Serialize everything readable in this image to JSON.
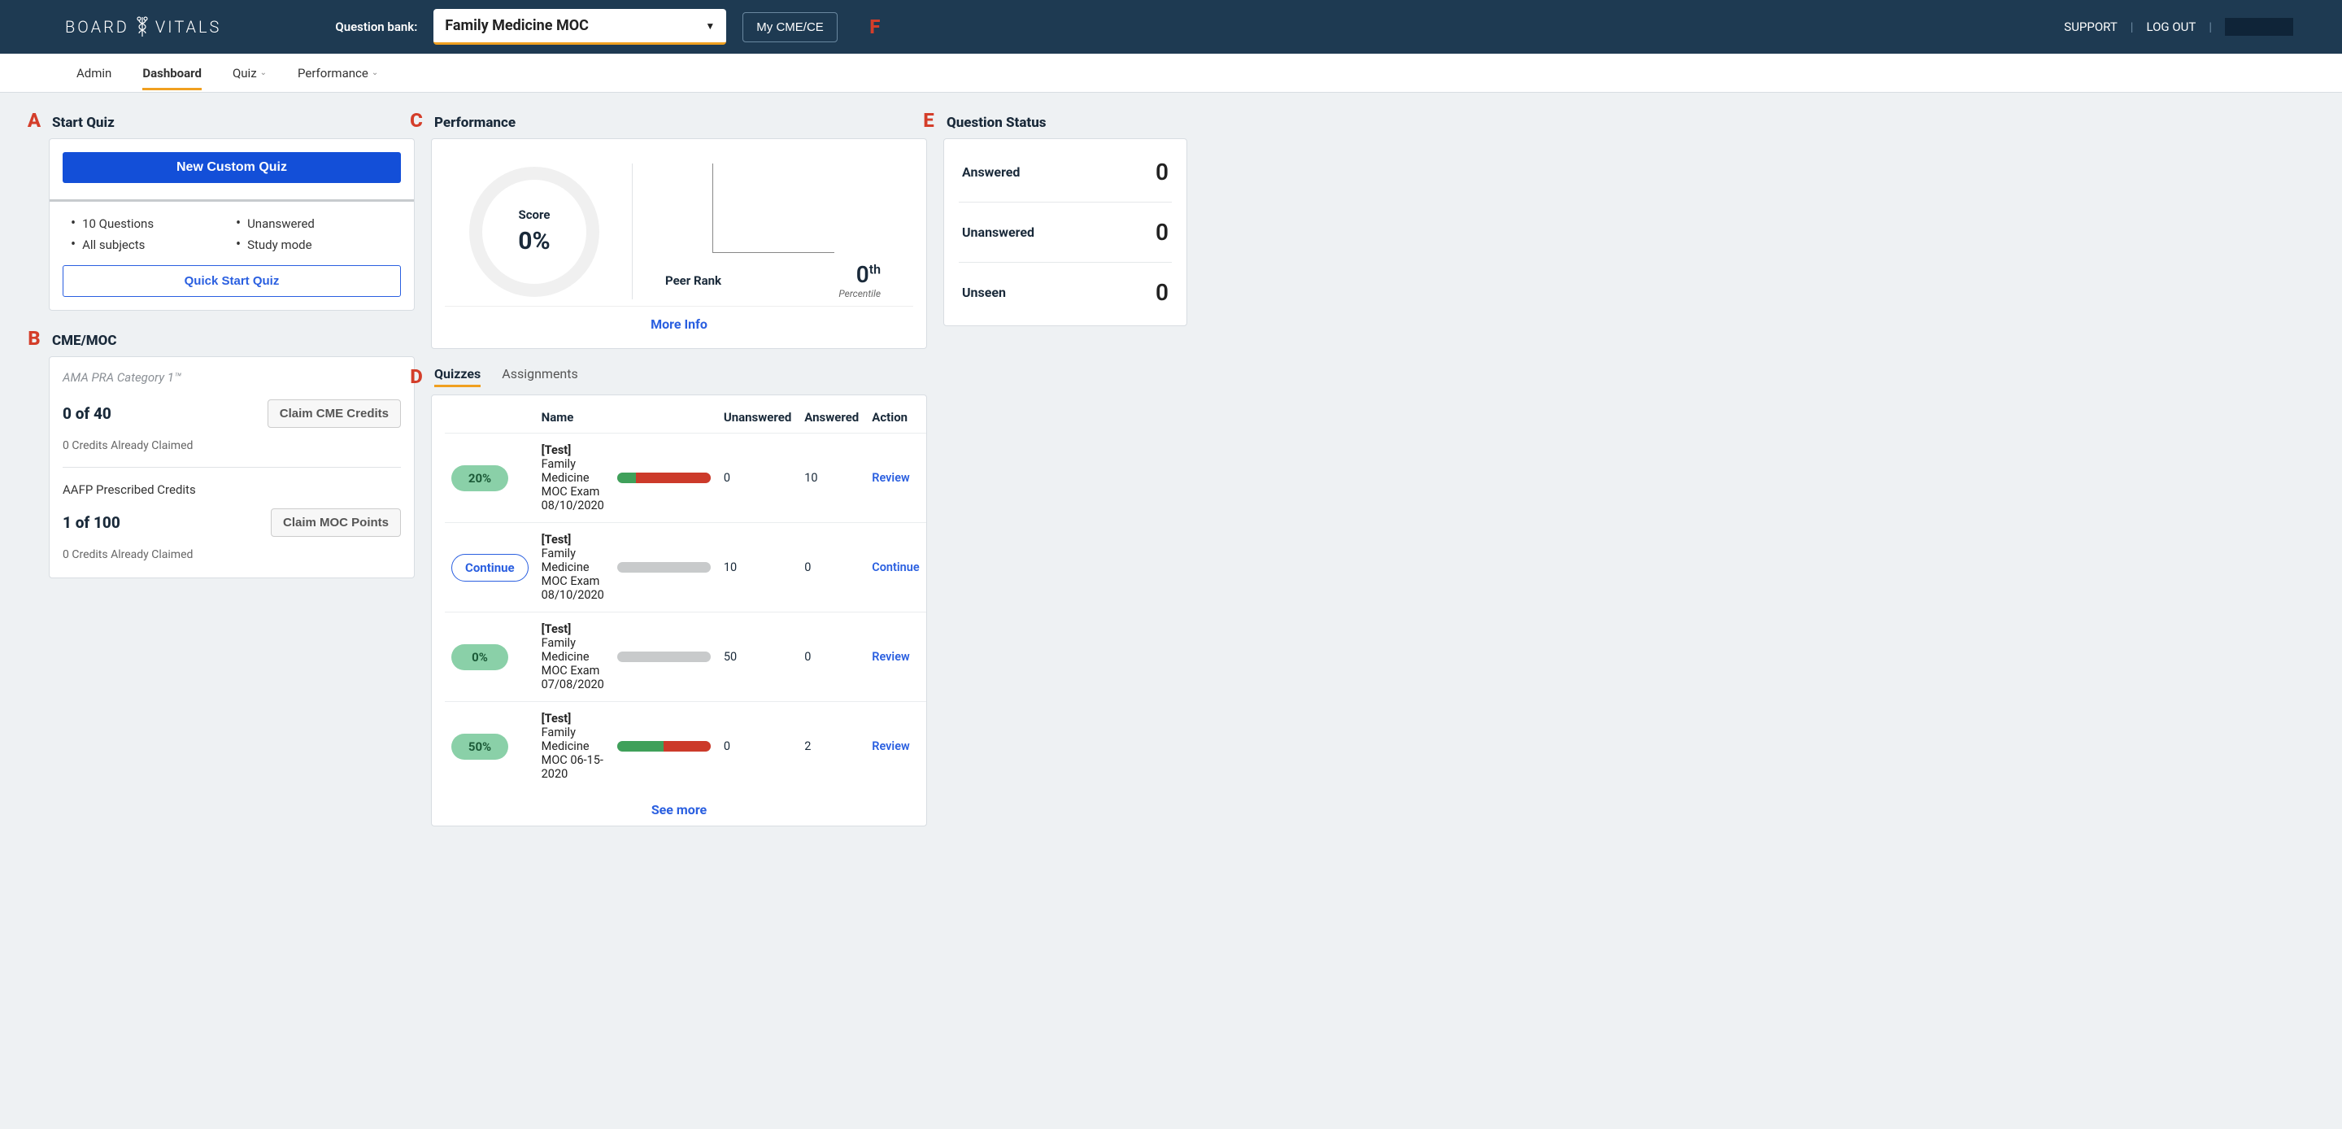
{
  "topbar": {
    "logo_left": "BOARD",
    "logo_right": "VITALS",
    "qbank_label": "Question bank:",
    "qbank_value": "Family Medicine MOC",
    "cme_button": "My CME/CE",
    "support": "SUPPORT",
    "logout": "LOG OUT"
  },
  "callouts": {
    "a": "A",
    "b": "B",
    "c": "C",
    "d": "D",
    "e": "E",
    "f": "F"
  },
  "subnav": {
    "admin": "Admin",
    "dashboard": "Dashboard",
    "quiz": "Quiz",
    "performance": "Performance"
  },
  "start_quiz": {
    "title": "Start Quiz",
    "new_custom": "New Custom Quiz",
    "bullets": [
      "10 Questions",
      "Unanswered",
      "All subjects",
      "Study mode"
    ],
    "quick_start": "Quick Start Quiz"
  },
  "cme": {
    "title": "CME/MOC",
    "category": "AMA PRA Category 1™",
    "count1": "0 of 40",
    "claim_cme": "Claim CME Credits",
    "claimed1": "0 Credits Already Claimed",
    "aafp": "AAFP Prescribed Credits",
    "count2": "1 of 100",
    "claim_moc": "Claim MOC Points",
    "claimed2": "0 Credits Already Claimed"
  },
  "performance": {
    "title": "Performance",
    "score_label": "Score",
    "score_value": "0%",
    "peer_rank_label": "Peer Rank",
    "peer_rank_value": "0",
    "peer_rank_suffix": "th",
    "percentile": "Percentile",
    "more_info": "More Info"
  },
  "quizzes": {
    "tab_quizzes": "Quizzes",
    "tab_assignments": "Assignments",
    "headers": {
      "name": "Name",
      "unanswered": "Unanswered",
      "answered": "Answered",
      "action": "Action"
    },
    "rows": [
      {
        "pill": "20%",
        "pill_kind": "green",
        "name_prefix": "[Test]",
        "name": "Family Medicine MOC Exam 08/10/2020",
        "bar_green": 20,
        "bar_red": 80,
        "unanswered": "0",
        "answered": "10",
        "action": "Review"
      },
      {
        "pill": "Continue",
        "pill_kind": "outline",
        "name_prefix": "[Test]",
        "name": "Family Medicine MOC Exam 08/10/2020",
        "bar_green": 0,
        "bar_red": 0,
        "unanswered": "10",
        "answered": "0",
        "action": "Continue"
      },
      {
        "pill": "0%",
        "pill_kind": "green",
        "name_prefix": "[Test]",
        "name": "Family Medicine MOC Exam 07/08/2020",
        "bar_green": 0,
        "bar_red": 0,
        "unanswered": "50",
        "answered": "0",
        "action": "Review"
      },
      {
        "pill": "50%",
        "pill_kind": "green",
        "name_prefix": "[Test]",
        "name": "Family Medicine MOC 06-15-2020",
        "bar_green": 50,
        "bar_red": 50,
        "unanswered": "0",
        "answered": "2",
        "action": "Review"
      }
    ],
    "see_more": "See more"
  },
  "question_status": {
    "title": "Question Status",
    "rows": [
      {
        "label": "Answered",
        "value": "0"
      },
      {
        "label": "Unanswered",
        "value": "0"
      },
      {
        "label": "Unseen",
        "value": "0"
      }
    ]
  }
}
